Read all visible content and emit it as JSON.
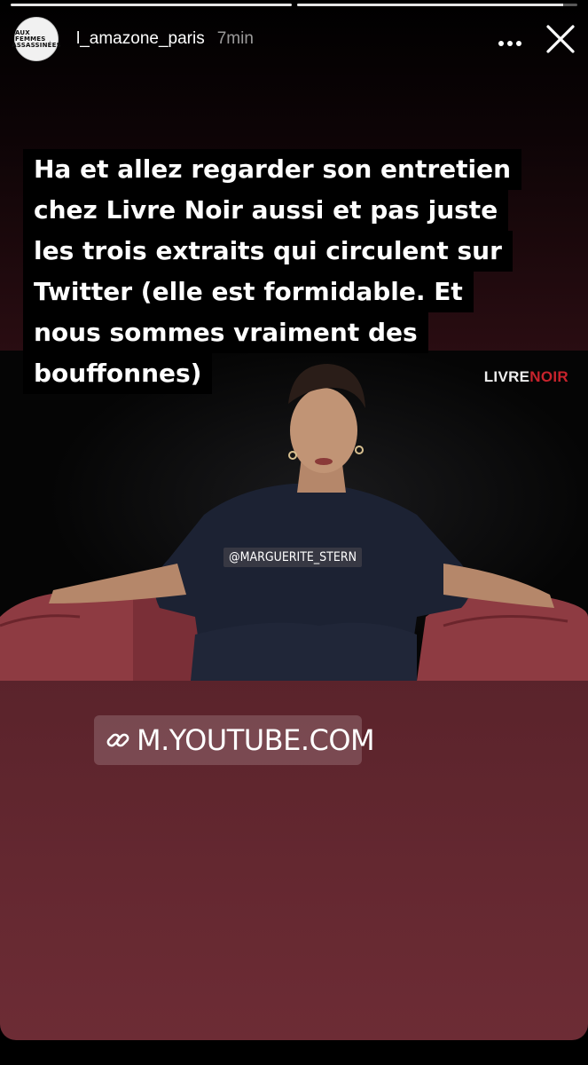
{
  "story": {
    "segments": [
      1,
      0.95
    ],
    "account": {
      "avatar_text": [
        "AUX FEMMES",
        "ASSASSINÉES"
      ],
      "username": "l_amazone_paris",
      "time": "7min"
    },
    "icons": {
      "more": "more-dots-icon",
      "close": "close-icon",
      "link": "link-icon"
    }
  },
  "video": {
    "brand_part1": "LIVRE",
    "brand_part2": "NOIR",
    "tag": "@MARGUERITE_STERN",
    "colors": {
      "armchair": "#8e3b42",
      "shirt": "#1c2233"
    }
  },
  "caption": {
    "lines": [
      "Ha et allez regarder son entretien",
      "chez Livre Noir aussi et pas juste",
      "les trois extraits qui circulent sur",
      "Twitter (elle est formidable. Et",
      "nous sommes vraiment des",
      "bouffonnes)"
    ]
  },
  "link": {
    "label": "M.YOUTUBE.COM"
  }
}
